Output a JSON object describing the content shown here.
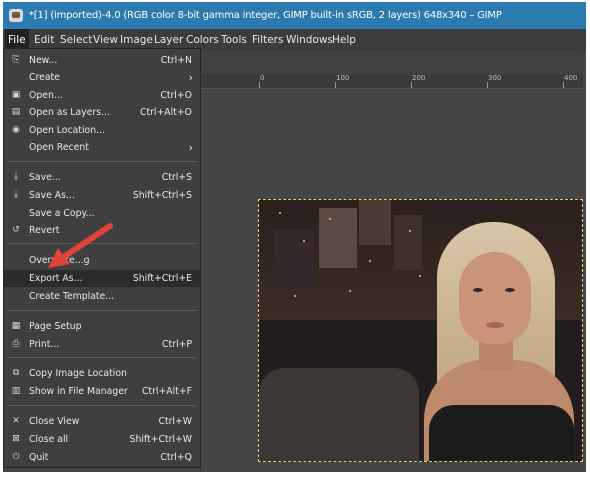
{
  "window": {
    "title": "*[1] (imported)-4.0 (RGB color 8-bit gamma integer, GIMP built-in sRGB, 2 layers) 648x340 – GIMP"
  },
  "menubar": [
    "File",
    "Edit",
    "Select",
    "View",
    "Image",
    "Layer",
    "Colors",
    "Tools",
    "Filters",
    "Windows",
    "Help"
  ],
  "ruler": {
    "labels": [
      "0",
      "100",
      "200",
      "300",
      "400"
    ]
  },
  "file_menu": {
    "items": [
      {
        "icon": "⎘",
        "label": "New...",
        "shortcut": "Ctrl+N"
      },
      {
        "label": "Create",
        "submenu": "›"
      },
      {
        "icon": "▣",
        "label": "Open...",
        "shortcut": "Ctrl+O"
      },
      {
        "icon": "▤",
        "label": "Open as Layers...",
        "shortcut": "Ctrl+Alt+O"
      },
      {
        "icon": "◉",
        "label": "Open Location...",
        "shortcut": ""
      },
      {
        "label": "Open Recent",
        "submenu": "›"
      },
      {
        "icon": "⤓",
        "label": "Save...",
        "shortcut": "Ctrl+S"
      },
      {
        "icon": "⤓",
        "label": "Save As...",
        "shortcut": "Shift+Ctrl+S"
      },
      {
        "label": "Save a Copy...",
        "shortcut": ""
      },
      {
        "icon": "↺",
        "label": "Revert",
        "shortcut": ""
      },
      {
        "label": "Overwrite...g",
        "shortcut": ""
      },
      {
        "label": "Export As...",
        "shortcut": "Shift+Ctrl+E"
      },
      {
        "label": "Create Template...",
        "shortcut": ""
      },
      {
        "icon": "▦",
        "label": "Page Setup",
        "shortcut": ""
      },
      {
        "icon": "⎙",
        "label": "Print...",
        "shortcut": "Ctrl+P"
      },
      {
        "icon": "⧉",
        "label": "Copy Image Location",
        "shortcut": ""
      },
      {
        "icon": "▥",
        "label": "Show in File Manager",
        "shortcut": "Ctrl+Alt+F"
      },
      {
        "icon": "✕",
        "label": "Close View",
        "shortcut": "Ctrl+W"
      },
      {
        "icon": "⊠",
        "label": "Close all",
        "shortcut": "Shift+Ctrl+W"
      },
      {
        "icon": "⏻",
        "label": "Quit",
        "shortcut": "Ctrl+Q"
      }
    ]
  },
  "colors": {
    "titlebar": "#2b7ab0",
    "highlight_row": "#2b2b2b",
    "annotation_arrow": "#e0433a",
    "selection_border": "#e0d36a"
  }
}
